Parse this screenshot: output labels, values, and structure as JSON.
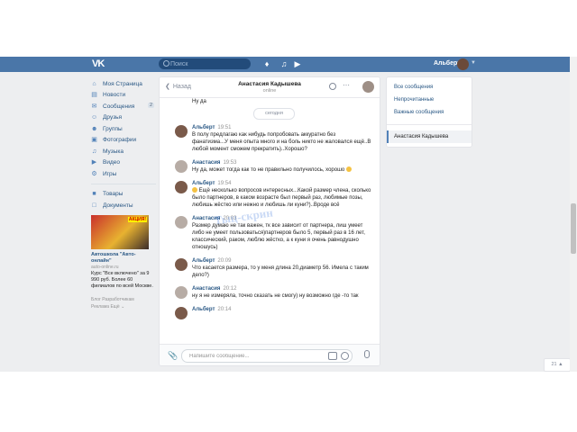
{
  "topbar": {
    "logo": "VK",
    "search_placeholder": "Поиск",
    "user_name": "Альберт",
    "icons": [
      "bell-icon",
      "music-icon",
      "play-icon"
    ]
  },
  "sidebar": {
    "items": [
      {
        "label": "Моя Страница",
        "icon": "home-icon"
      },
      {
        "label": "Новости",
        "icon": "news-icon"
      },
      {
        "label": "Сообщения",
        "icon": "messages-icon",
        "badge": "2"
      },
      {
        "label": "Друзья",
        "icon": "friends-icon"
      },
      {
        "label": "Группы",
        "icon": "groups-icon"
      },
      {
        "label": "Фотографии",
        "icon": "photos-icon"
      },
      {
        "label": "Музыка",
        "icon": "music-icon"
      },
      {
        "label": "Видео",
        "icon": "video-icon"
      },
      {
        "label": "Игры",
        "icon": "games-icon"
      }
    ],
    "items2": [
      {
        "label": "Товары",
        "icon": "market-icon"
      },
      {
        "label": "Документы",
        "icon": "docs-icon"
      }
    ],
    "ad": {
      "badge": "АКЦИЯ!",
      "title": "Автошкола \"Авто-онлайн\"",
      "site": "auto-online.ru",
      "desc": "Курс \"Все включено\" за 9 990 руб. Более 60 филиалов по всей Москве."
    },
    "footer": {
      "line1": "Блог  Разработчикам",
      "line2": "Реклама  Ещё ⌄"
    }
  },
  "chat": {
    "back_label": "Назад",
    "contact_name": "Анастасия Кадышева",
    "status": "online",
    "date_divider": "сегодня",
    "messages": [
      {
        "author": "",
        "time": "",
        "text": "Ну да"
      },
      {
        "author": "Альберт",
        "time": "19:51",
        "text": "В полу предлагаю как нибудь попробовать аккуратно без фанатизма...У меня опыта много и на боль никто не жаловался ещё..В любой момент сможем прекратить)..Хорошо?"
      },
      {
        "author": "Анастасия",
        "time": "19:53",
        "text": "Ну да, может тогда как то не правильно получилось, хорошо"
      },
      {
        "author": "Альберт",
        "time": "19:54",
        "text": "Ещё несколько вопросов интересных...Какой размер члена, сколько было партнеров, в каком возрасте был первый раз, любимые позы, любишь жёстко или нежно и любишь ли куни?)..Вроде всё"
      },
      {
        "author": "Анастасия",
        "time": "20:03",
        "text": "Размер думаю не так важен, тк все зависит от партнера, лиш умеет либо не умеет пользоваться)партнеров было 5, первый раз в 16 лет, классический, раком, люблю жёстко, а к куни я очень равнодушно отношусь)"
      },
      {
        "author": "Альберт",
        "time": "20:09",
        "text": "Что касается размера, то у меня длина 20,диаметр 56. Имела с таким дело?)"
      },
      {
        "author": "Анастасия",
        "time": "20:12",
        "text": "ну я не измеряла, точно сказать не смогу) ну возможно где -то так"
      },
      {
        "author": "Альберт",
        "time": "20:14",
        "text": ""
      }
    ],
    "watermark": "Тыц-скрин",
    "input_placeholder": "Напишите сообщение..."
  },
  "right_panel": {
    "filters": [
      "Все сообщения",
      "Непрочитанные",
      "Важные сообщения"
    ],
    "active_dialog": "Анастасия Кадышева"
  },
  "mini_chat": {
    "label": "21 ▲"
  }
}
